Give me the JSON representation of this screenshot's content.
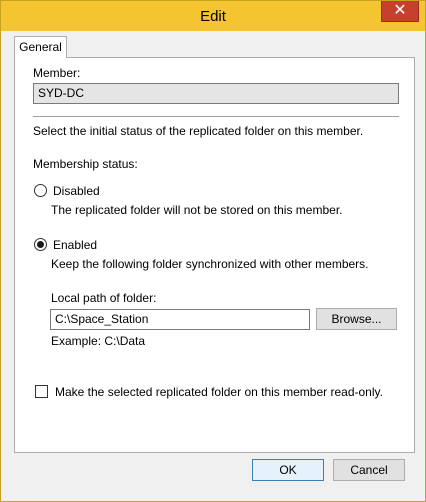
{
  "window": {
    "title": "Edit",
    "close_glyph": "✕"
  },
  "tabs": [
    {
      "label": "General"
    }
  ],
  "member": {
    "label": "Member:",
    "value": "SYD-DC"
  },
  "instruction": "Select the initial status of the replicated folder on this member.",
  "membership": {
    "label": "Membership status:",
    "options": [
      {
        "label": "Disabled",
        "description": "The replicated folder will not be stored on this member.",
        "selected": false
      },
      {
        "label": "Enabled",
        "description": "Keep the following folder synchronized with other members.",
        "selected": true
      }
    ]
  },
  "local_path": {
    "label": "Local path of folder:",
    "value": "C:\\Space_Station",
    "browse_label": "Browse...",
    "example": "Example: C:\\Data"
  },
  "read_only": {
    "label": "Make the selected replicated folder on this member read-only.",
    "checked": false
  },
  "buttons": {
    "ok": "OK",
    "cancel": "Cancel"
  },
  "colors": {
    "titlebar": "#f4c431",
    "close": "#c7402f",
    "accent": "#3c7fb1"
  }
}
